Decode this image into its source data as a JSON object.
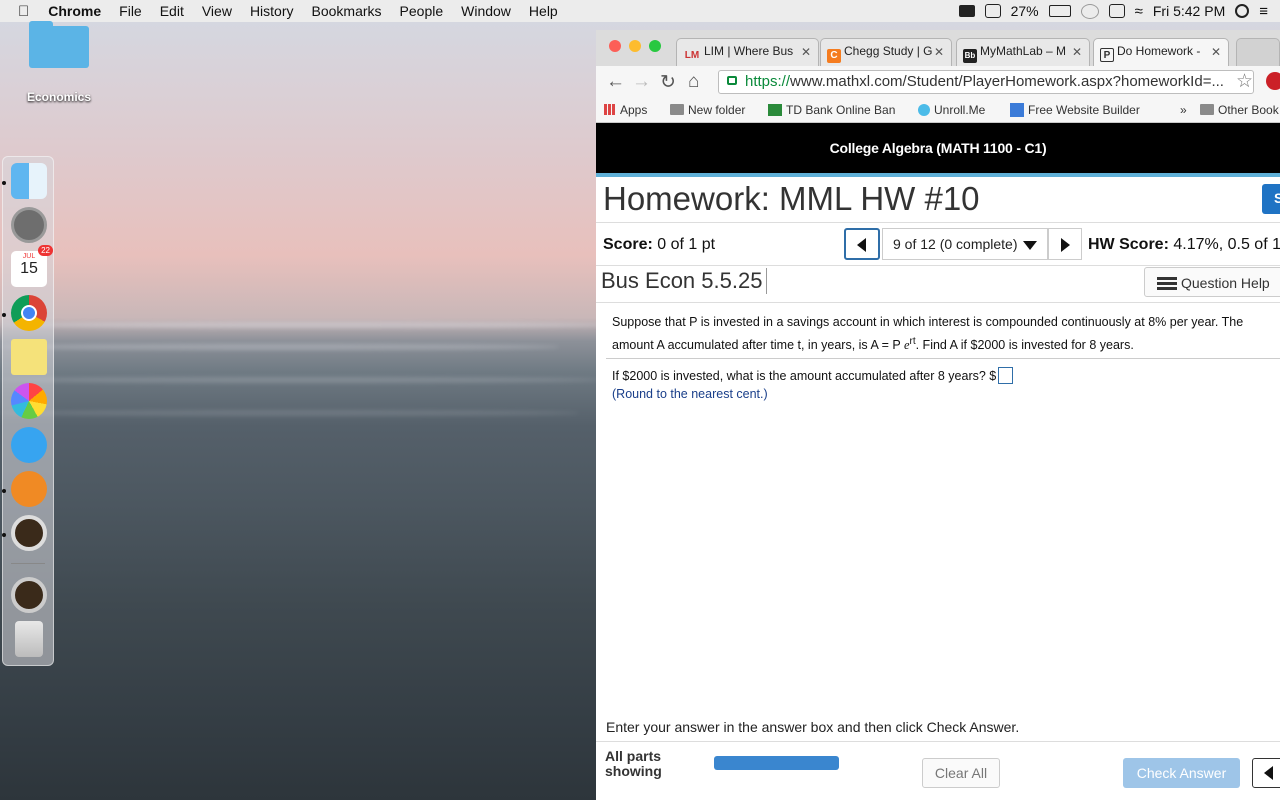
{
  "menubar": {
    "app_name": "Chrome",
    "items": [
      "File",
      "Edit",
      "View",
      "History",
      "Bookmarks",
      "People",
      "Window",
      "Help"
    ],
    "battery": "27%",
    "clock": "Fri 5:42 PM"
  },
  "desktop": {
    "folder_label": "Economics",
    "calendar_month": "JUL",
    "calendar_day": "15",
    "calendar_badge": "22"
  },
  "browser": {
    "tabs": [
      {
        "label": "LIM | Where Bus",
        "icon": "LM"
      },
      {
        "label": "Chegg Study | G",
        "icon": "C"
      },
      {
        "label": "MyMathLab – M",
        "icon": "Bb"
      },
      {
        "label": "Do Homework -",
        "icon": "P"
      }
    ],
    "url_scheme": "https://",
    "url_rest": "www.mathxl.com/Student/PlayerHomework.aspx?homeworkId=...",
    "bookmarks": [
      "Apps",
      "New folder",
      "TD Bank Online Ban",
      "Unroll.Me",
      "Free Website Builder",
      "Other Book"
    ],
    "bookmarks_overflow": "»"
  },
  "page": {
    "course": "College Algebra (MATH 1100 - C1)",
    "title": "Homework: MML HW #10",
    "save_label": "S",
    "score_label": "Score:",
    "score_value": " 0 of 1 pt",
    "question_nav": "9 of 12 (0 complete)",
    "hw_score_label": "HW Score:",
    "hw_score_value": " 4.17%, 0.5 of 1",
    "question_id": "Bus Econ 5.5.25",
    "help_label": "Question Help",
    "problem_a": "Suppose that P is invested in a savings account in which interest is compounded continuously at 8% per year. The amount A accumulated after time t, in years, is A = P ",
    "problem_e": "e",
    "problem_rt": "rt",
    "problem_b": ". Find A if $2000 is invested for 8 years.",
    "question": "If $2000 is invested, what is the amount accumulated after 8 years? $",
    "round_note": "(Round to the nearest cent.)",
    "instruction": "Enter your answer in the answer box and then click Check Answer.",
    "all_parts_line1": "All parts",
    "all_parts_line2": "showing",
    "clear_label": "Clear All",
    "check_label": "Check Answer"
  },
  "colors": {
    "accent_blue": "#1f73c4",
    "check_button": "#9ec5e8",
    "course_bar": "#000000",
    "url_green": "#0b8a3b"
  }
}
